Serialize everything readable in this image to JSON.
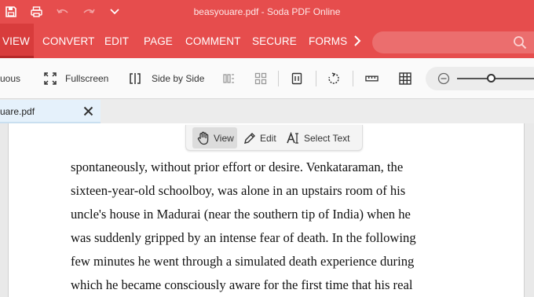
{
  "app": {
    "title": "beasyouare.pdf - Soda PDF Online",
    "quick_access": [
      "save-icon",
      "print-icon",
      "undo-icon",
      "redo-icon",
      "chevron-down-icon"
    ]
  },
  "menu": {
    "items": [
      {
        "label": "VIEW",
        "active": true
      },
      {
        "label": "CONVERT"
      },
      {
        "label": "EDIT"
      },
      {
        "label": "PAGE"
      },
      {
        "label": "COMMENT"
      },
      {
        "label": "SECURE"
      },
      {
        "label": "FORMS"
      }
    ],
    "more_icon": "chevron-right-icon",
    "search": {
      "value": "",
      "icon": "search-icon"
    }
  },
  "toolbar": {
    "continuous_label": "uous",
    "fullscreen_label": "Fullscreen",
    "side_by_side_label": "Side by Side",
    "icons": [
      "split-view-icon",
      "thumbnails-icon",
      "single-page-icon",
      "rotate-icon",
      "ruler-icon",
      "grid-icon",
      "zoom-out-icon"
    ],
    "zoom_level": 0.45
  },
  "tabs": {
    "document_name": "uare.pdf"
  },
  "mode_bar": {
    "view_label": "View",
    "edit_label": "Edit",
    "select_label": "Select Text",
    "active": "View"
  },
  "document": {
    "lines": [
      "spontaneously, without prior effort or desire. Venkataraman, the",
      "sixteen-year-old schoolboy, was alone in an upstairs room of his",
      "uncle's house in Madurai (near the southern tip of India) when he",
      "was suddenly gripped by an intense fear of death. In the following",
      "few minutes he went through a simulated death experience during",
      "which he became consciously aware for the first time that his real"
    ]
  },
  "colors": {
    "brand_red": "#e64d4d",
    "active_menu": "#d83c3c",
    "tab_blue": "#e5f1fb"
  }
}
